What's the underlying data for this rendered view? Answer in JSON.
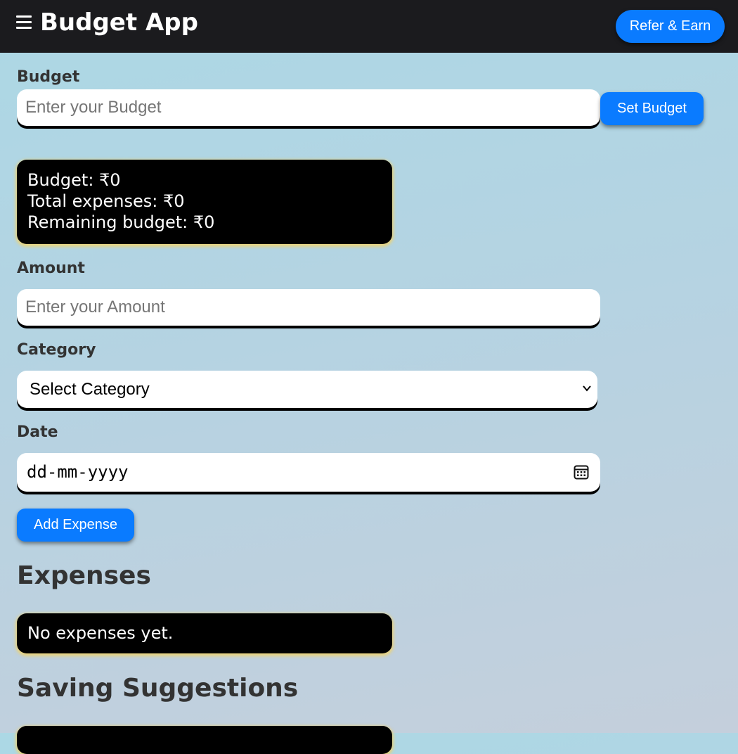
{
  "app": {
    "title": "Budget App",
    "refer_button": "Refer & Earn"
  },
  "budget": {
    "label": "Budget",
    "placeholder": "Enter your Budget",
    "set_button": "Set Budget"
  },
  "summary": {
    "budget_line": "Budget: ₹0",
    "total_expenses_line": "Total expenses: ₹0",
    "remaining_line": "Remaining budget: ₹0"
  },
  "amount": {
    "label": "Amount",
    "placeholder": "Enter your Amount"
  },
  "category": {
    "label": "Category",
    "selected": "Select Category"
  },
  "date": {
    "label": "Date",
    "placeholder": "dd-mm-yyyy"
  },
  "add_button": "Add Expense",
  "expenses": {
    "heading": "Expenses",
    "empty_text": "No expenses yet."
  },
  "suggestions": {
    "heading": "Saving Suggestions"
  },
  "icons": {
    "menu": "menu-icon",
    "dropdown": "chevron-down-icon",
    "date": "calendar-icon"
  },
  "colors": {
    "accent": "#0a7bff",
    "navbar": "#1b1b1e",
    "card": "#000000",
    "card_glow": "#eed26e"
  }
}
